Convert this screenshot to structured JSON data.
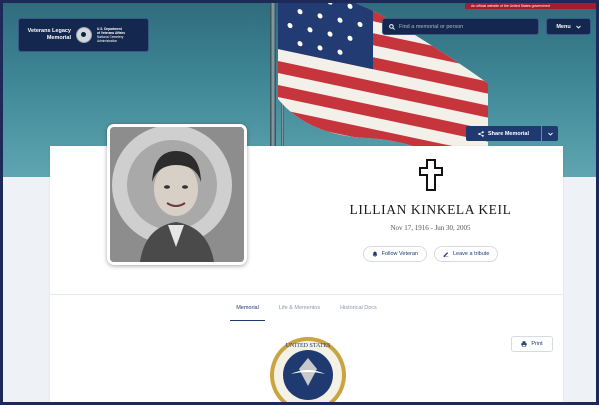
{
  "top_banner": {
    "text": "An official website of the United States government"
  },
  "header": {
    "logo_title": "Veterans Legacy Memorial",
    "va_line1": "U.S. Department",
    "va_line2": "of Veterans Affairs",
    "va_line3": "National Cemetery",
    "va_line4": "Administration",
    "search_placeholder": "Find a memorial or person",
    "menu_label": "Menu"
  },
  "share": {
    "label": "Share Memorial"
  },
  "profile": {
    "name": "LILLIAN KINKELA KEIL",
    "dates": "Nov 17, 1916 - Jun 30, 2005",
    "emblem_symbol": "latin-cross",
    "follow_label": "Follow Veteran",
    "tribute_label": "Leave a tribute"
  },
  "tabs": [
    {
      "label": "Memorial",
      "active": true
    },
    {
      "label": "Life & Mementos",
      "active": false
    },
    {
      "label": "Historical Docs",
      "active": false
    }
  ],
  "content": {
    "print_label": "Print",
    "branch_emblem": "air-force-seal"
  },
  "colors": {
    "navy": "#1e3a71",
    "frame": "#1d2a58",
    "hero_teal": "#3f8796"
  }
}
